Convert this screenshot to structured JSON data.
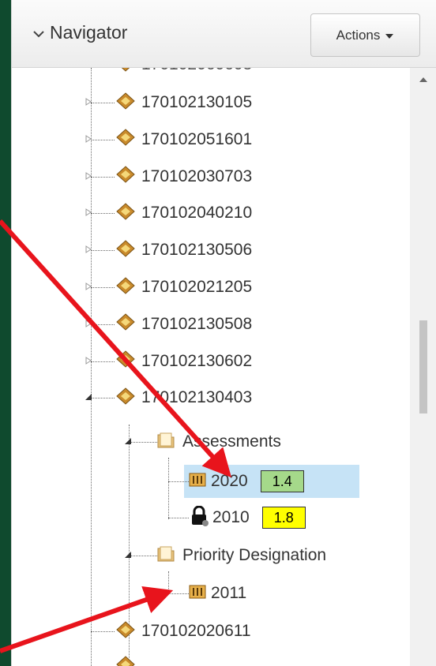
{
  "header": {
    "title": "Navigator",
    "actions_label": "Actions"
  },
  "tree": {
    "sites": [
      "170102130105",
      "170102051601",
      "170102030703",
      "170102040210",
      "170102130506",
      "170102021205",
      "170102130508",
      "170102130602",
      "170102130403"
    ],
    "assessments_label": "Assessments",
    "assessments": [
      {
        "year": "2020",
        "score": "1.4",
        "score_color": "#a5d98a",
        "locked": false
      },
      {
        "year": "2010",
        "score": "1.8",
        "score_color": "#ffff00",
        "locked": true
      }
    ],
    "priority_label": "Priority Designation",
    "priority_items": [
      {
        "year": "2011"
      }
    ],
    "site_after": "170102020611"
  },
  "colors": {
    "frame": "#0f4a2e",
    "highlight": "#c6e3f6",
    "arrow": "#e8141c"
  }
}
